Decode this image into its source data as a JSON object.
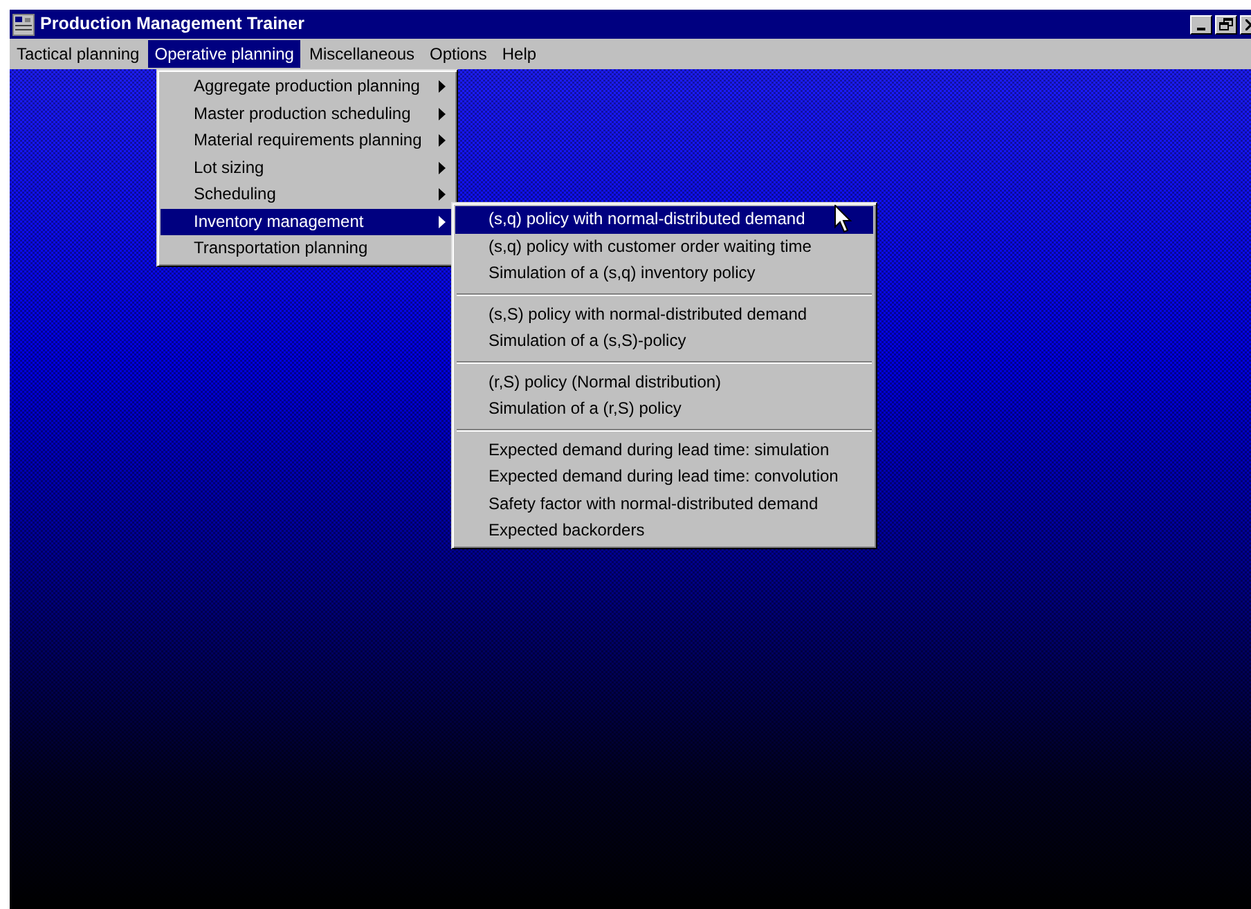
{
  "window": {
    "title": "Production Management Trainer"
  },
  "menubar": [
    {
      "label": "Tactical planning",
      "selected": false
    },
    {
      "label": "Operative planning",
      "selected": true
    },
    {
      "label": "Miscellaneous",
      "selected": false
    },
    {
      "label": "Options",
      "selected": false
    },
    {
      "label": "Help",
      "selected": false
    }
  ],
  "dropdown": {
    "items": [
      {
        "label": "Aggregate production planning",
        "has_submenu": true,
        "selected": false
      },
      {
        "label": "Master production scheduling",
        "has_submenu": true,
        "selected": false
      },
      {
        "label": "Material requirements planning",
        "has_submenu": true,
        "selected": false
      },
      {
        "label": "Lot sizing",
        "has_submenu": true,
        "selected": false
      },
      {
        "label": "Scheduling",
        "has_submenu": true,
        "selected": false
      },
      {
        "label": "Inventory management",
        "has_submenu": true,
        "selected": true
      },
      {
        "label": "Transportation planning",
        "has_submenu": false,
        "selected": false
      }
    ]
  },
  "submenu": {
    "groups": [
      {
        "items": [
          {
            "label": "(s,q) policy with normal-distributed demand",
            "selected": true
          },
          {
            "label": "(s,q) policy with customer order waiting time",
            "selected": false
          },
          {
            "label": "Simulation of a (s,q) inventory policy",
            "selected": false
          }
        ]
      },
      {
        "items": [
          {
            "label": "(s,S) policy with normal-distributed demand",
            "selected": false
          },
          {
            "label": "Simulation of a (s,S)-policy",
            "selected": false
          }
        ]
      },
      {
        "items": [
          {
            "label": "(r,S) policy (Normal distribution)",
            "selected": false
          },
          {
            "label": "Simulation of a (r,S) policy",
            "selected": false
          }
        ]
      },
      {
        "items": [
          {
            "label": "Expected demand during lead time: simulation",
            "selected": false
          },
          {
            "label": "Expected demand during lead time: convolution",
            "selected": false
          },
          {
            "label": "Safety factor with normal-distributed demand",
            "selected": false
          },
          {
            "label": "Expected backorders",
            "selected": false
          }
        ]
      }
    ]
  }
}
